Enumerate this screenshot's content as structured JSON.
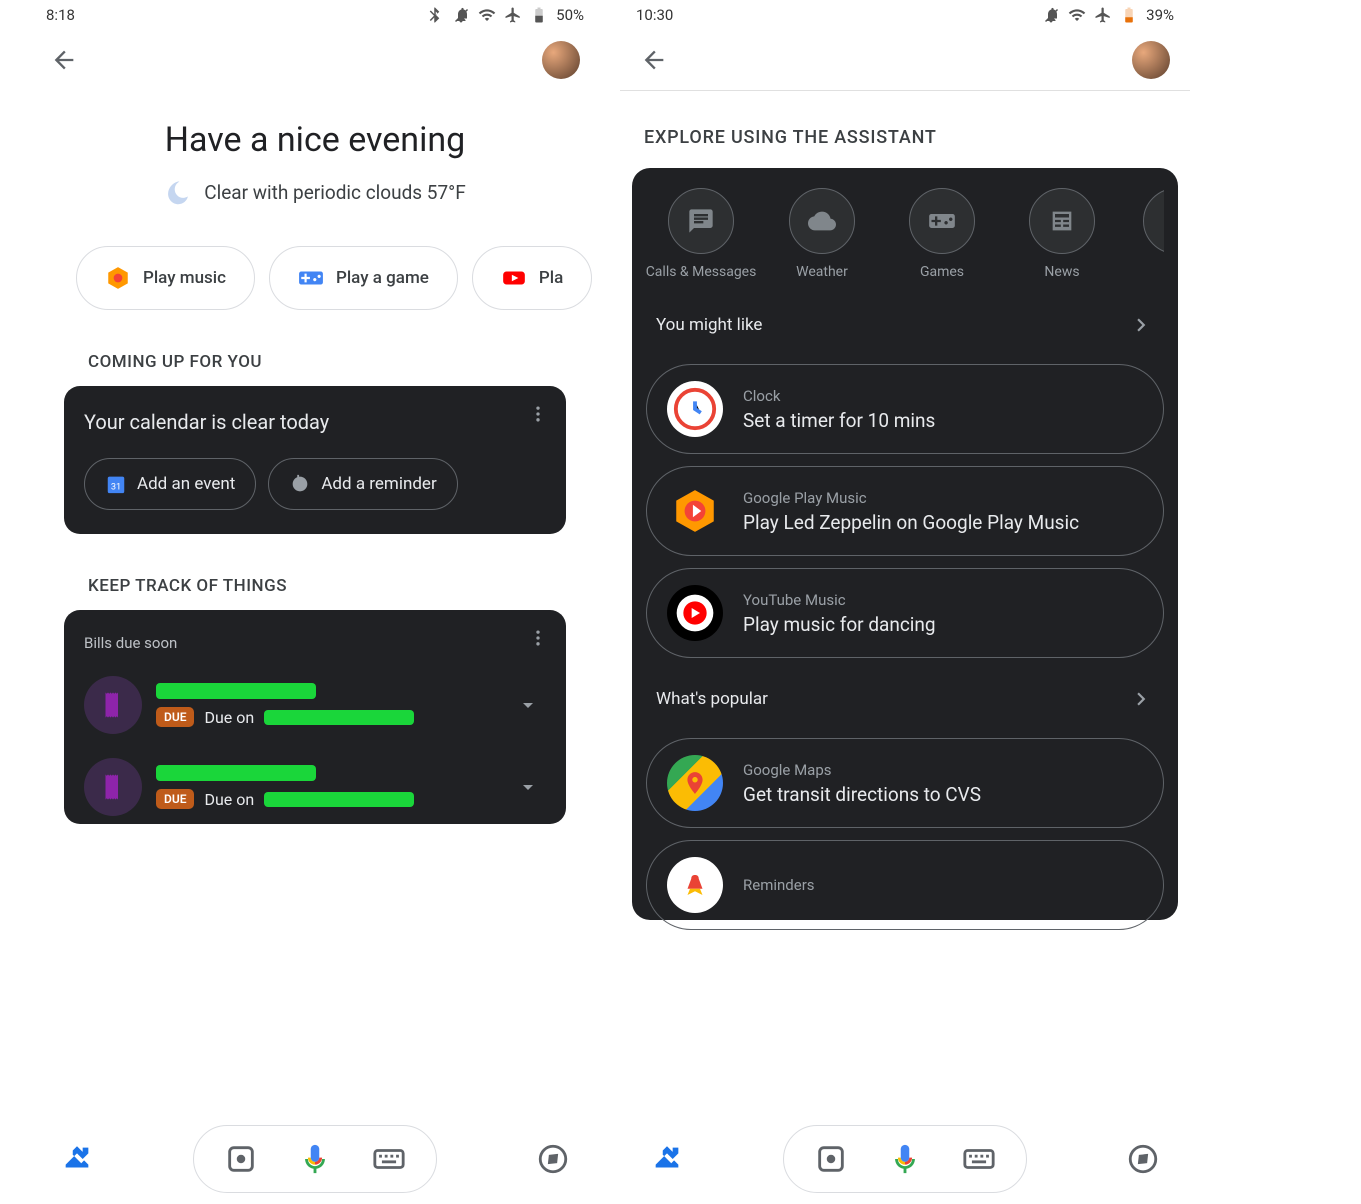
{
  "left": {
    "status": {
      "time": "8:18",
      "battery": "50%"
    },
    "greeting": "Have a nice evening",
    "weather": "Clear with periodic clouds 57°F",
    "chips": [
      {
        "label": "Play music"
      },
      {
        "label": "Play a game"
      },
      {
        "label": "Pla"
      }
    ],
    "sections": {
      "coming_up": "COMING UP FOR YOU",
      "keep_track": "KEEP TRACK OF THINGS"
    },
    "calendar_card": {
      "title": "Your calendar is clear today",
      "add_event": "Add an event",
      "add_reminder": "Add a reminder"
    },
    "bills_card": {
      "subtitle": "Bills due soon",
      "rows": [
        {
          "due_badge": "DUE",
          "due_text": "Due on"
        },
        {
          "due_badge": "DUE",
          "due_text": "Due on"
        }
      ]
    }
  },
  "right": {
    "status": {
      "time": "10:30",
      "battery": "39%"
    },
    "explore_header": "EXPLORE USING THE ASSISTANT",
    "categories": [
      {
        "label": "Calls & Messages"
      },
      {
        "label": "Weather"
      },
      {
        "label": "Games"
      },
      {
        "label": "News"
      }
    ],
    "you_might_like": "You might like",
    "whats_popular": "What's popular",
    "suggestions_like": [
      {
        "app": "Clock",
        "text": "Set a timer for 10 mins"
      },
      {
        "app": "Google Play Music",
        "text": "Play Led Zeppelin on Google Play Music"
      },
      {
        "app": "YouTube Music",
        "text": "Play music for dancing"
      }
    ],
    "suggestions_popular": [
      {
        "app": "Google Maps",
        "text": "Get transit directions to CVS"
      },
      {
        "app": "Reminders",
        "text": ""
      }
    ]
  }
}
